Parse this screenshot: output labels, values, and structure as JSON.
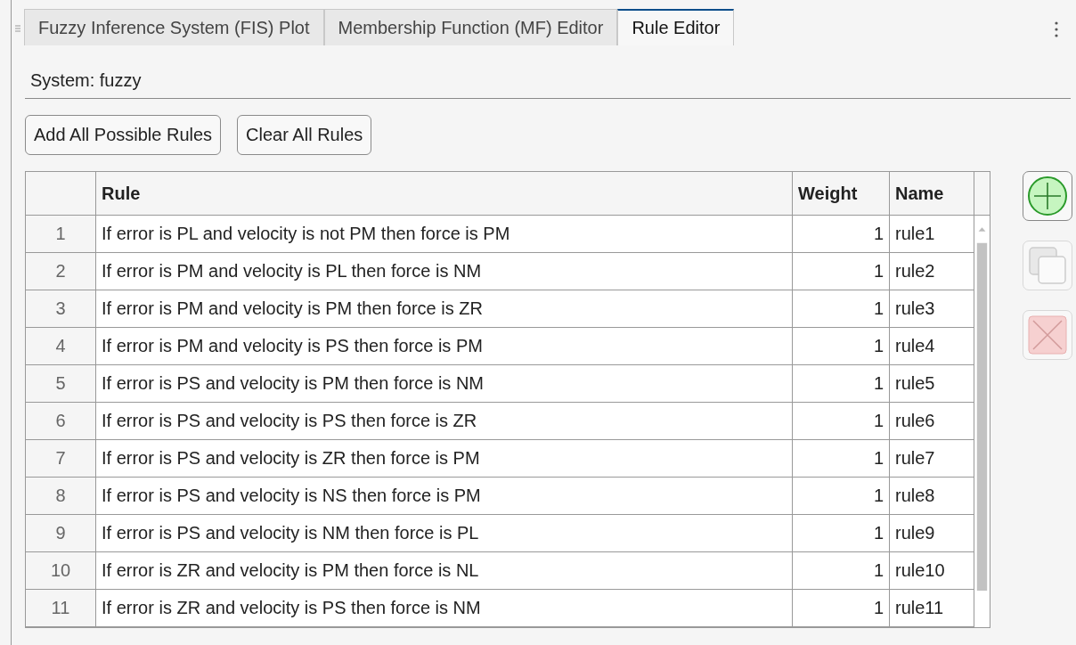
{
  "tabs": [
    {
      "label": "Fuzzy Inference System (FIS) Plot",
      "selected": false
    },
    {
      "label": "Membership Function (MF) Editor",
      "selected": false
    },
    {
      "label": "Rule Editor",
      "selected": true
    }
  ],
  "system_label": "System: fuzzy",
  "buttons": [
    "Add All Possible Rules",
    "Clear All Rules"
  ],
  "table": {
    "columns": [
      "Rule",
      "Weight",
      "Name"
    ],
    "rows": [
      {
        "number": "1",
        "rule": "If error is PL and velocity is not PM then force is PM",
        "weight": "1",
        "name": "rule1"
      },
      {
        "number": "2",
        "rule": "If error is PM and velocity is PL then force is NM",
        "weight": "1",
        "name": "rule2"
      },
      {
        "number": "3",
        "rule": "If error is PM and velocity is PM then force is ZR",
        "weight": "1",
        "name": "rule3"
      },
      {
        "number": "4",
        "rule": "If error is PM and velocity is PS then force is PM",
        "weight": "1",
        "name": "rule4"
      },
      {
        "number": "5",
        "rule": "If error is PS and velocity is PM then force is NM",
        "weight": "1",
        "name": "rule5"
      },
      {
        "number": "6",
        "rule": "If error is PS and velocity is PS then force is ZR",
        "weight": "1",
        "name": "rule6"
      },
      {
        "number": "7",
        "rule": "If error is PS and velocity is ZR then force is PM",
        "weight": "1",
        "name": "rule7"
      },
      {
        "number": "8",
        "rule": "If error is PS and velocity is NS then force is PM",
        "weight": "1",
        "name": "rule8"
      },
      {
        "number": "9",
        "rule": "If error is PS and velocity is NM then force is PL",
        "weight": "1",
        "name": "rule9"
      },
      {
        "number": "10",
        "rule": "If error is ZR and velocity is PM then force is NL",
        "weight": "1",
        "name": "rule10"
      },
      {
        "number": "11",
        "rule": "If error is ZR and velocity is PS then force is NM",
        "weight": "1",
        "name": "rule11"
      }
    ]
  },
  "side_buttons": [
    {
      "kind": "add",
      "disabled": false
    },
    {
      "kind": "copy",
      "disabled": true
    },
    {
      "kind": "delete",
      "disabled": true
    }
  ]
}
